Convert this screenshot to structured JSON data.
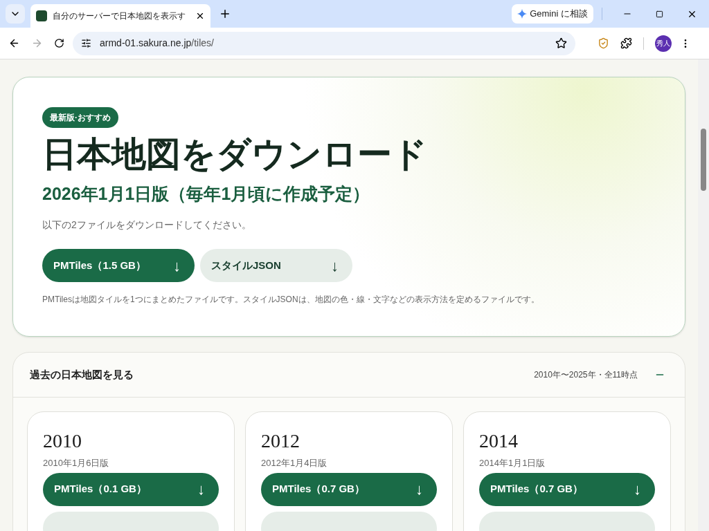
{
  "browser": {
    "tab_title": "自分のサーバーで日本地図を表示す",
    "url_host": "armd-01.sakura.ne.jp",
    "url_path": "/tiles/",
    "gemini_label": "Gemini に相談",
    "avatar": "秀人"
  },
  "hero": {
    "badge": "最新版·おすすめ",
    "title": "日本地図をダウンロード",
    "subtitle": "2026年1月1日版（毎年1月頃に作成予定）",
    "instruction": "以下の2ファイルをダウンロードしてください。",
    "buttons": [
      {
        "kind": "primary",
        "label": "PMTiles（1.5 GB）",
        "arrow": "↓"
      },
      {
        "kind": "secondary",
        "label": "スタイルJSON",
        "arrow": "↓"
      }
    ],
    "note": "PMTilesは地図タイルを1つにまとめたファイルです。スタイルJSONは、地図の色・線・文字などの表示方法を定めるファイルです。"
  },
  "past": {
    "title": "過去の日本地図を見る",
    "summary": "2010年〜2025年・全11時点",
    "expanded": true,
    "cards": [
      {
        "year": "2010",
        "date": "2010年1月6日版",
        "button": "PMTiles（0.1 GB）",
        "arrow": "↓"
      },
      {
        "year": "2012",
        "date": "2012年1月4日版",
        "button": "PMTiles（0.7 GB）",
        "arrow": "↓"
      },
      {
        "year": "2014",
        "date": "2014年1月1日版",
        "button": "PMTiles（0.7 GB）",
        "arrow": "↓"
      }
    ]
  }
}
